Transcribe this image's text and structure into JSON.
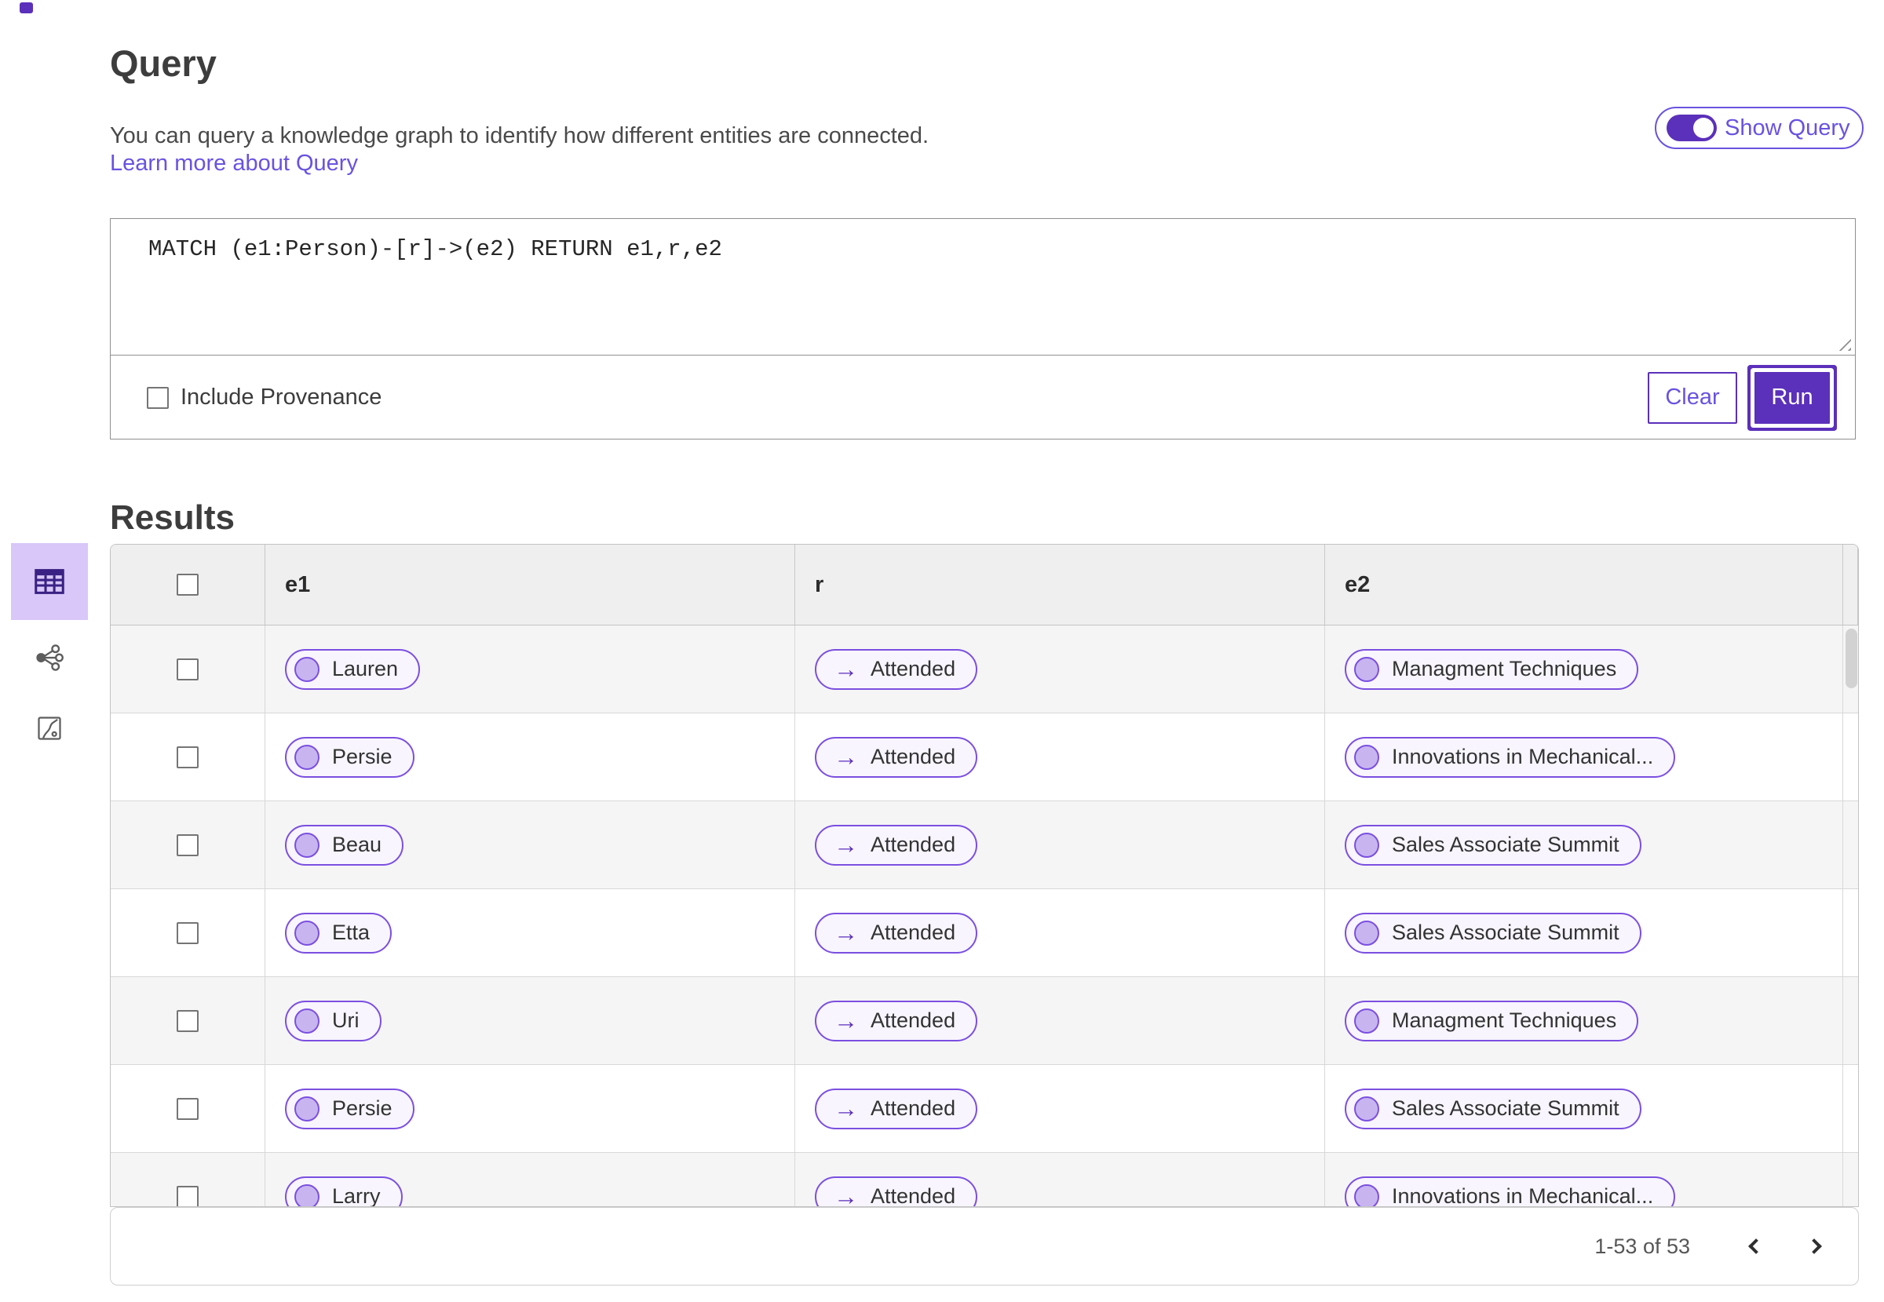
{
  "query": {
    "title": "Query",
    "description": "You can query a knowledge graph to identify how different entities are connected.",
    "learn_more_link": "Learn more about Query",
    "show_query": {
      "label": "Show Query",
      "state": "on"
    },
    "editor": {
      "value": "MATCH (e1:Person)-[r]->(e2) RETURN e1,r,e2"
    },
    "include_provenance": {
      "label": "Include Provenance",
      "checked": false
    },
    "buttons": {
      "clear": "Clear",
      "run": "Run"
    }
  },
  "results": {
    "title": "Results",
    "views": [
      {
        "name": "table-view",
        "active": true
      },
      {
        "name": "graph-view",
        "active": false
      },
      {
        "name": "chart-view",
        "active": false
      }
    ],
    "table": {
      "columns": [
        "e1",
        "r",
        "e2"
      ],
      "rows": [
        {
          "e1": "Lauren",
          "r": "Attended",
          "e2": "Managment Techniques"
        },
        {
          "e1": "Persie",
          "r": "Attended",
          "e2": "Innovations in Mechanical..."
        },
        {
          "e1": "Beau",
          "r": "Attended",
          "e2": "Sales Associate Summit"
        },
        {
          "e1": "Etta",
          "r": "Attended",
          "e2": "Sales Associate Summit"
        },
        {
          "e1": "Uri",
          "r": "Attended",
          "e2": "Managment Techniques"
        },
        {
          "e1": "Persie",
          "r": "Attended",
          "e2": "Sales Associate Summit"
        },
        {
          "e1": "Larry",
          "r": "Attended",
          "e2": "Innovations in Mechanical..."
        }
      ]
    },
    "pagination": {
      "range": "1-53 of 53"
    }
  },
  "icons": {
    "arrow_right": "→"
  },
  "colors": {
    "primary": "#5b30ba",
    "link": "#6a52e0",
    "pill_border": "#7b4fe0",
    "pill_bg": "#f8f5fe",
    "node_fill": "#c8b5f0",
    "selected_view_bg": "#d8c7f8",
    "header_bg": "#efeff0",
    "row_alt_bg": "#f5f5f6"
  }
}
